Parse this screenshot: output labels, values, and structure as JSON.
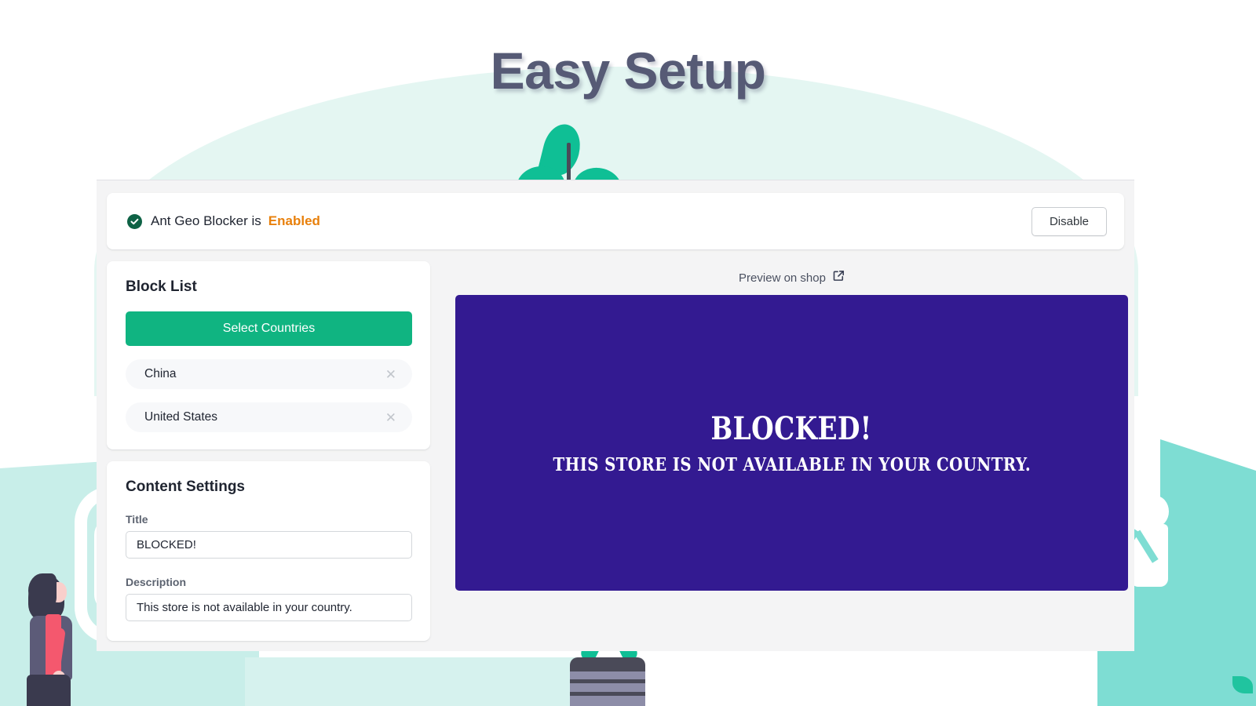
{
  "page": {
    "title": "Easy Setup"
  },
  "status_banner": {
    "check_icon": "check-circle-icon",
    "text": "Ant Geo Blocker is",
    "value": "Enabled",
    "value_color": "#E8800C",
    "disable_label": "Disable"
  },
  "block_list": {
    "heading": "Block List",
    "select_button_label": "Select Countries",
    "select_button_color": "#10B481",
    "remove_icon": "close-icon",
    "countries": [
      {
        "name": "China"
      },
      {
        "name": "United States"
      }
    ]
  },
  "content_settings": {
    "heading": "Content Settings",
    "fields": [
      {
        "label": "Title",
        "value": "BLOCKED!",
        "placeholder": "Title"
      },
      {
        "label": "Description",
        "value": "This store is not available in your country.",
        "placeholder": "Description"
      }
    ]
  },
  "preview": {
    "link_label": "Preview on shop",
    "link_icon": "external-link-icon",
    "background_color": "#331A91",
    "title": "BLOCKED!",
    "description": "This store is not available in your country."
  }
}
